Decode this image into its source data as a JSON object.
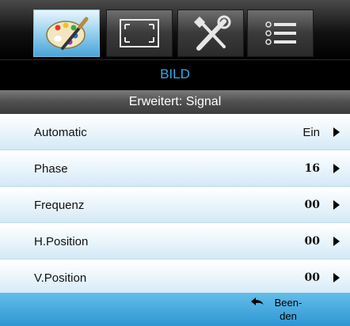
{
  "tabs": [
    {
      "icon": "palette-icon",
      "active": true
    },
    {
      "icon": "screen-resize-icon",
      "active": false
    },
    {
      "icon": "tools-icon",
      "active": false
    },
    {
      "icon": "list-menu-icon",
      "active": false
    }
  ],
  "menu": {
    "title": "BILD",
    "subtitle": "Erweitert: Signal"
  },
  "rows": [
    {
      "label": "Automatic",
      "value": "Ein"
    },
    {
      "label": "Phase",
      "value": "16"
    },
    {
      "label": "Frequenz",
      "value": "00"
    },
    {
      "label": "H.Position",
      "value": "00"
    },
    {
      "label": "V.Position",
      "value": "00"
    }
  ],
  "footer": {
    "exit_label": "Been-\nden"
  },
  "colors": {
    "accent": "#37a9e6",
    "active_tab": "#9fd3ef",
    "bottom_bar": "#3a9fd9"
  }
}
